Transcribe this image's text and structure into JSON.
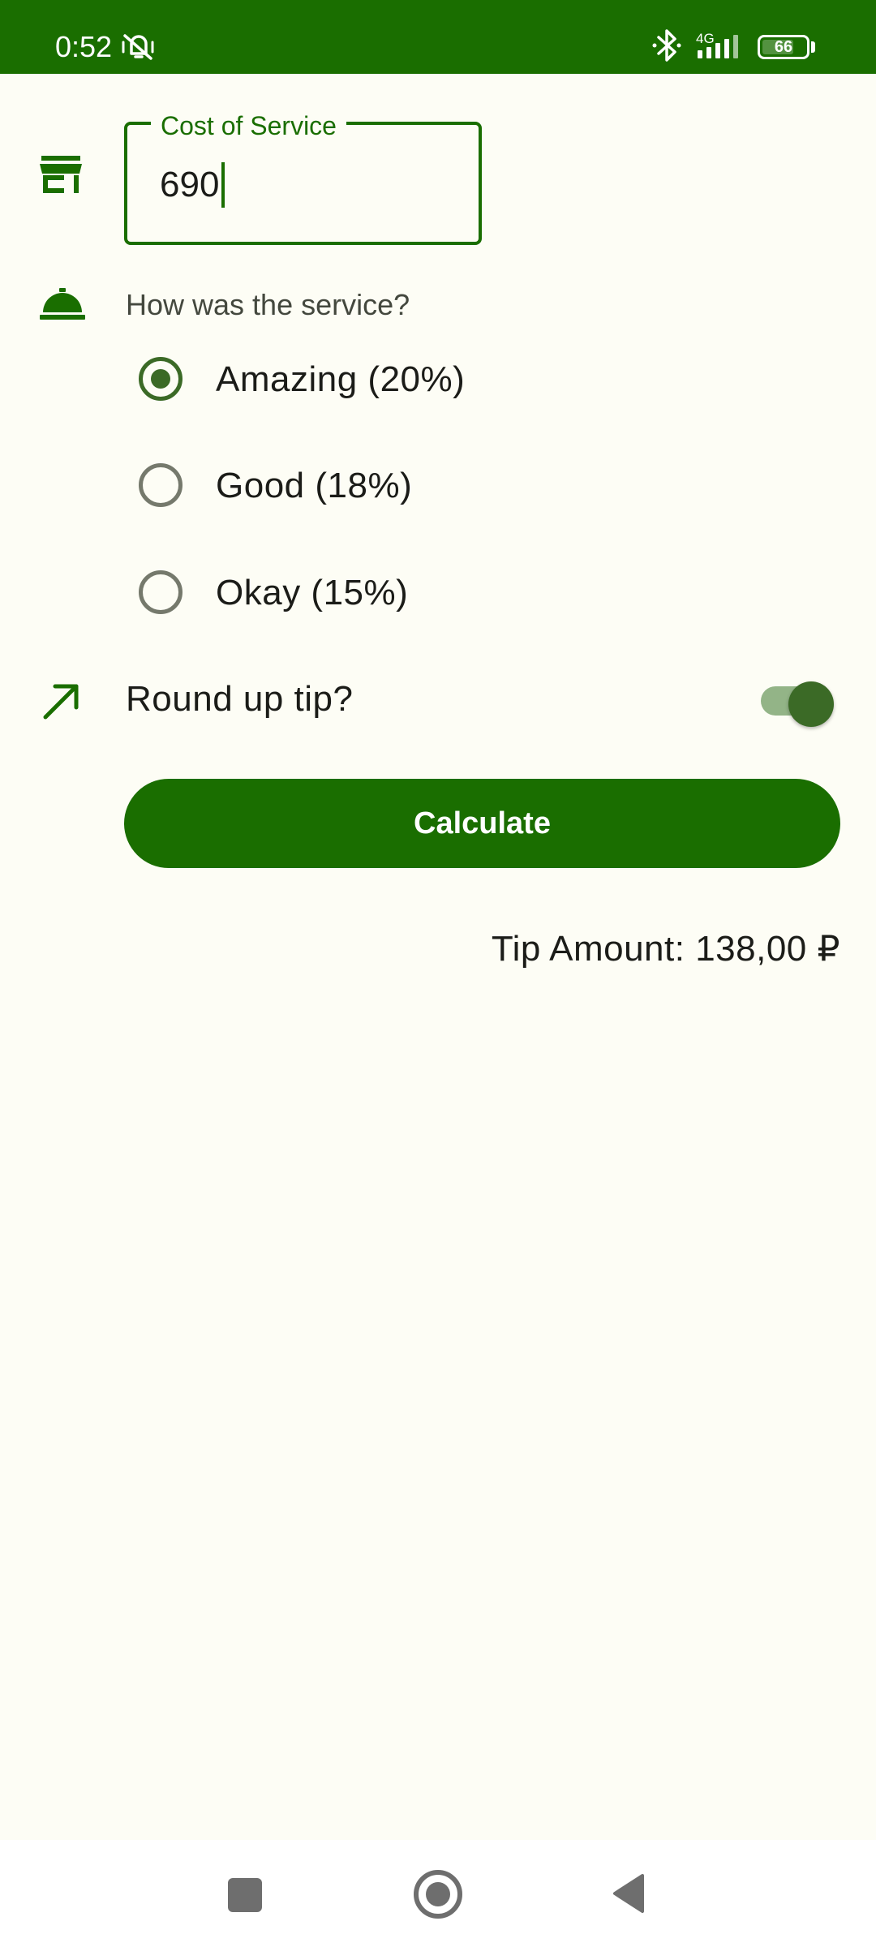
{
  "status_bar": {
    "time": "0:52",
    "network": "4G",
    "battery": "66",
    "battery_fraction": 0.66,
    "icons": [
      "mute-vibrate-icon",
      "bluetooth-icon",
      "signal-icon",
      "battery-icon"
    ],
    "background": "#1a6e00"
  },
  "cost_field": {
    "label": "Cost of Service",
    "value": "690",
    "icon": "storefront-icon"
  },
  "service": {
    "question": "How was the service?",
    "icon": "room-service-bell-icon",
    "options": [
      {
        "label": "Amazing (20%)",
        "selected": true
      },
      {
        "label": "Good (18%)",
        "selected": false
      },
      {
        "label": "Okay (15%)",
        "selected": false
      }
    ]
  },
  "round_up": {
    "label": "Round up tip?",
    "icon": "trending-up-arrow-icon",
    "checked": true
  },
  "calculate": {
    "label": "Calculate"
  },
  "result": {
    "text": "Tip Amount: 138,00 ₽"
  },
  "colors": {
    "primary": "#1a6e00",
    "radio_selected": "#3b6a26",
    "background": "#fdfdf5"
  },
  "nav_bar": {
    "icons": [
      "recents-square-icon",
      "home-circle-icon",
      "back-triangle-icon"
    ]
  }
}
